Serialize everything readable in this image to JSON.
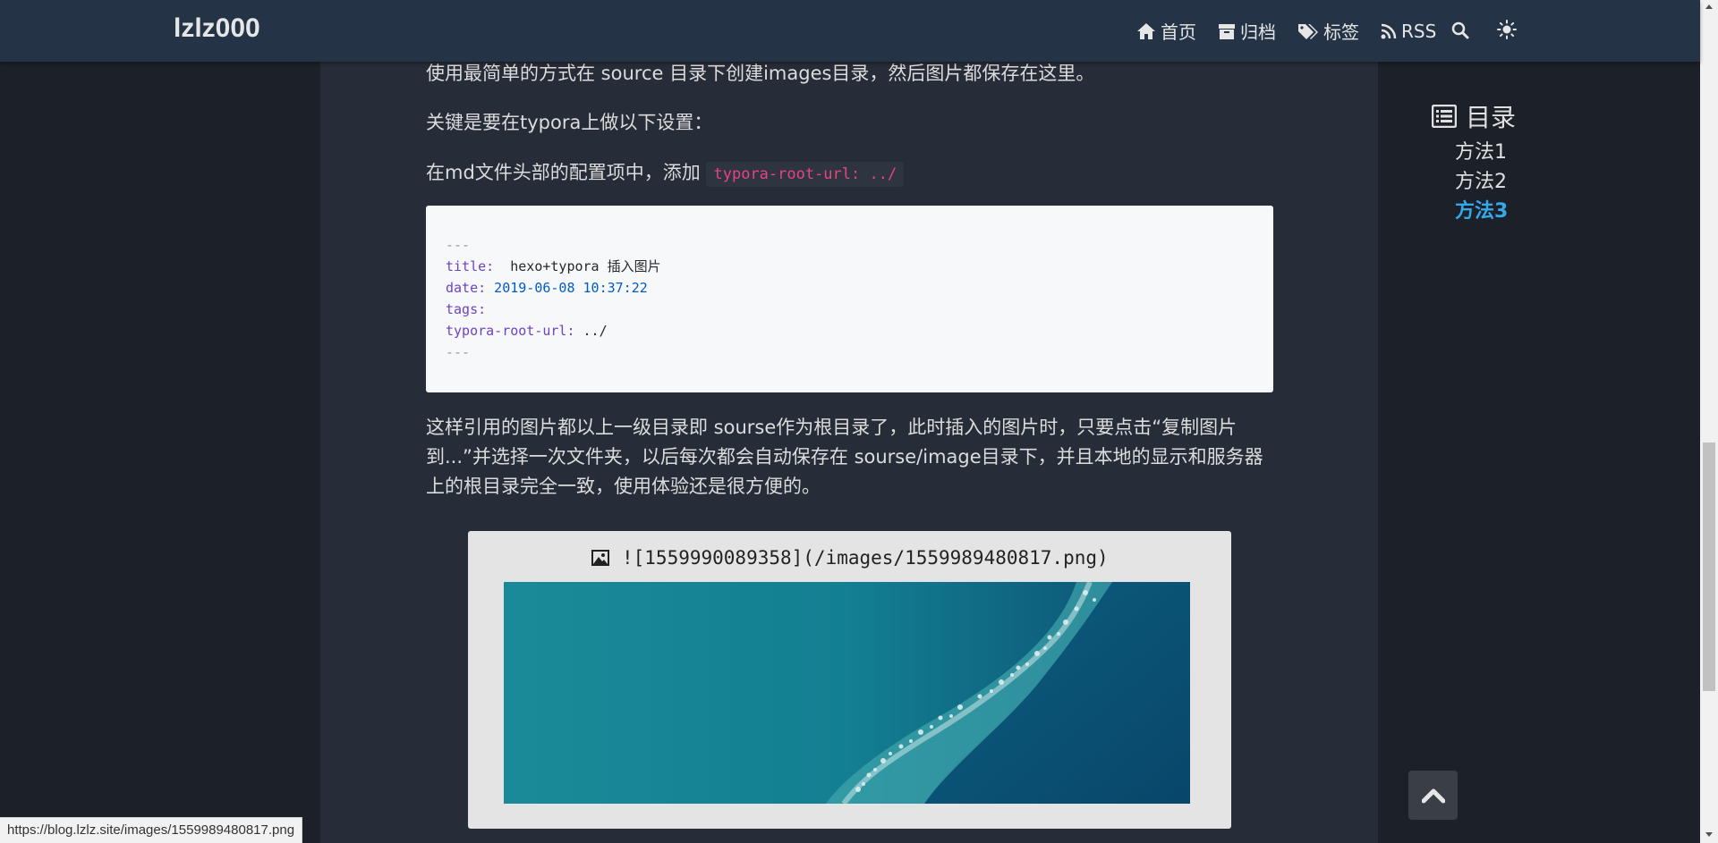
{
  "navbar": {
    "brand": "lzlz000",
    "items": [
      {
        "label": "首页",
        "icon": "home-icon"
      },
      {
        "label": "归档",
        "icon": "archive-icon"
      },
      {
        "label": "标签",
        "icon": "tags-icon"
      },
      {
        "label": "RSS",
        "icon": "rss-icon"
      }
    ],
    "search_icon": "search-icon",
    "theme_icon": "sun-icon"
  },
  "article": {
    "para1": "使用最简单的方式在 source 目录下创建images目录，然后图片都保存在这里。",
    "para2": "关键是要在typora上做以下设置：",
    "para3_prefix": "在md文件头部的配置项中，添加",
    "para3_code": "typora-root-url: ../",
    "code_block": {
      "line1": "---",
      "line2_key": "title:",
      "line2_val": "  hexo+typora 插入图片",
      "line3_key": "date:",
      "line3_val": " 2019-06-08 10:37:22",
      "line4_key": "tags:",
      "line5_key": "typora-root-url:",
      "line5_val": " ../",
      "line6": "---"
    },
    "para4": "这样引用的图片都以上一级目录即 sourse作为根目录了，此时插入的图片时，只要点击“复制图片到...”并选择一次文件夹，以后每次都会自动保存在 sourse/image目录下，并且本地的显示和服务器上的根目录完全一致，使用体验还是很方便的。",
    "figure_caption": "![1559990089358](/images/1559989480817.png)"
  },
  "toc": {
    "title": "目录",
    "items": [
      {
        "label": "方法1",
        "active": false
      },
      {
        "label": "方法2",
        "active": false
      },
      {
        "label": "方法3",
        "active": true
      }
    ]
  },
  "status_bar": {
    "url": "https://blog.lzlz.site/images/1559989480817.png"
  },
  "colors": {
    "navbar_bg": "#243345",
    "content_bg": "#272d38",
    "page_bg": "#1b2029",
    "toc_active": "#35a8e8",
    "inline_code": "#e8447f"
  }
}
